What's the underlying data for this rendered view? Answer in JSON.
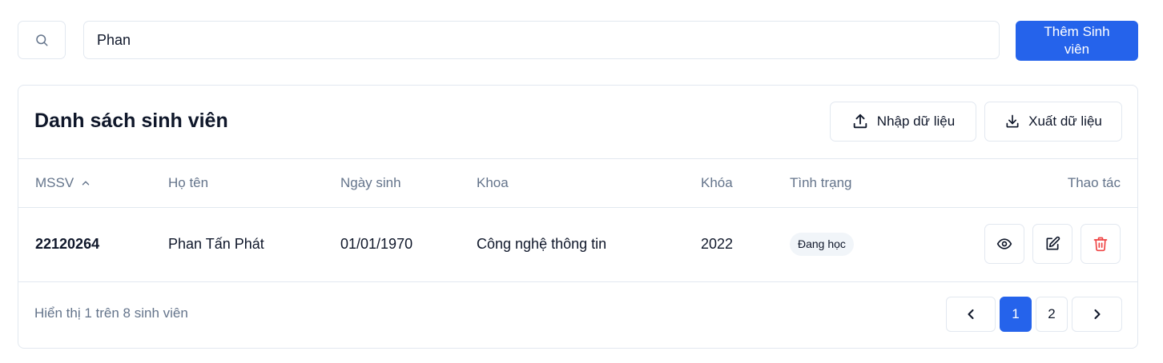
{
  "search": {
    "value": "Phan",
    "icon": "search-icon"
  },
  "toolbar": {
    "add_label_line1": "Thêm Sinh",
    "add_label_line2": "viên"
  },
  "card": {
    "title": "Danh sách sinh viên",
    "import_label": "Nhập dữ liệu",
    "export_label": "Xuất dữ liệu"
  },
  "table": {
    "headers": {
      "mssv": "MSSV",
      "name": "Họ tên",
      "dob": "Ngày sinh",
      "faculty": "Khoa",
      "cohort": "Khóa",
      "status": "Tình trạng",
      "actions": "Thao tác"
    },
    "sort": {
      "column": "MSSV",
      "direction": "ascending"
    },
    "rows": [
      {
        "mssv": "22120264",
        "name": "Phan Tấn Phát",
        "dob": "01/01/1970",
        "faculty": "Công nghệ thông tin",
        "cohort": "2022",
        "status": "Đang học"
      }
    ]
  },
  "footer": {
    "summary": "Hiển thị 1 trên 8 sinh viên"
  },
  "pagination": {
    "pages": [
      "1",
      "2"
    ],
    "current": "1"
  },
  "colors": {
    "accent": "#2563eb",
    "delete": "#ef4444",
    "muted": "#64748b",
    "border": "#e2e8f0"
  }
}
